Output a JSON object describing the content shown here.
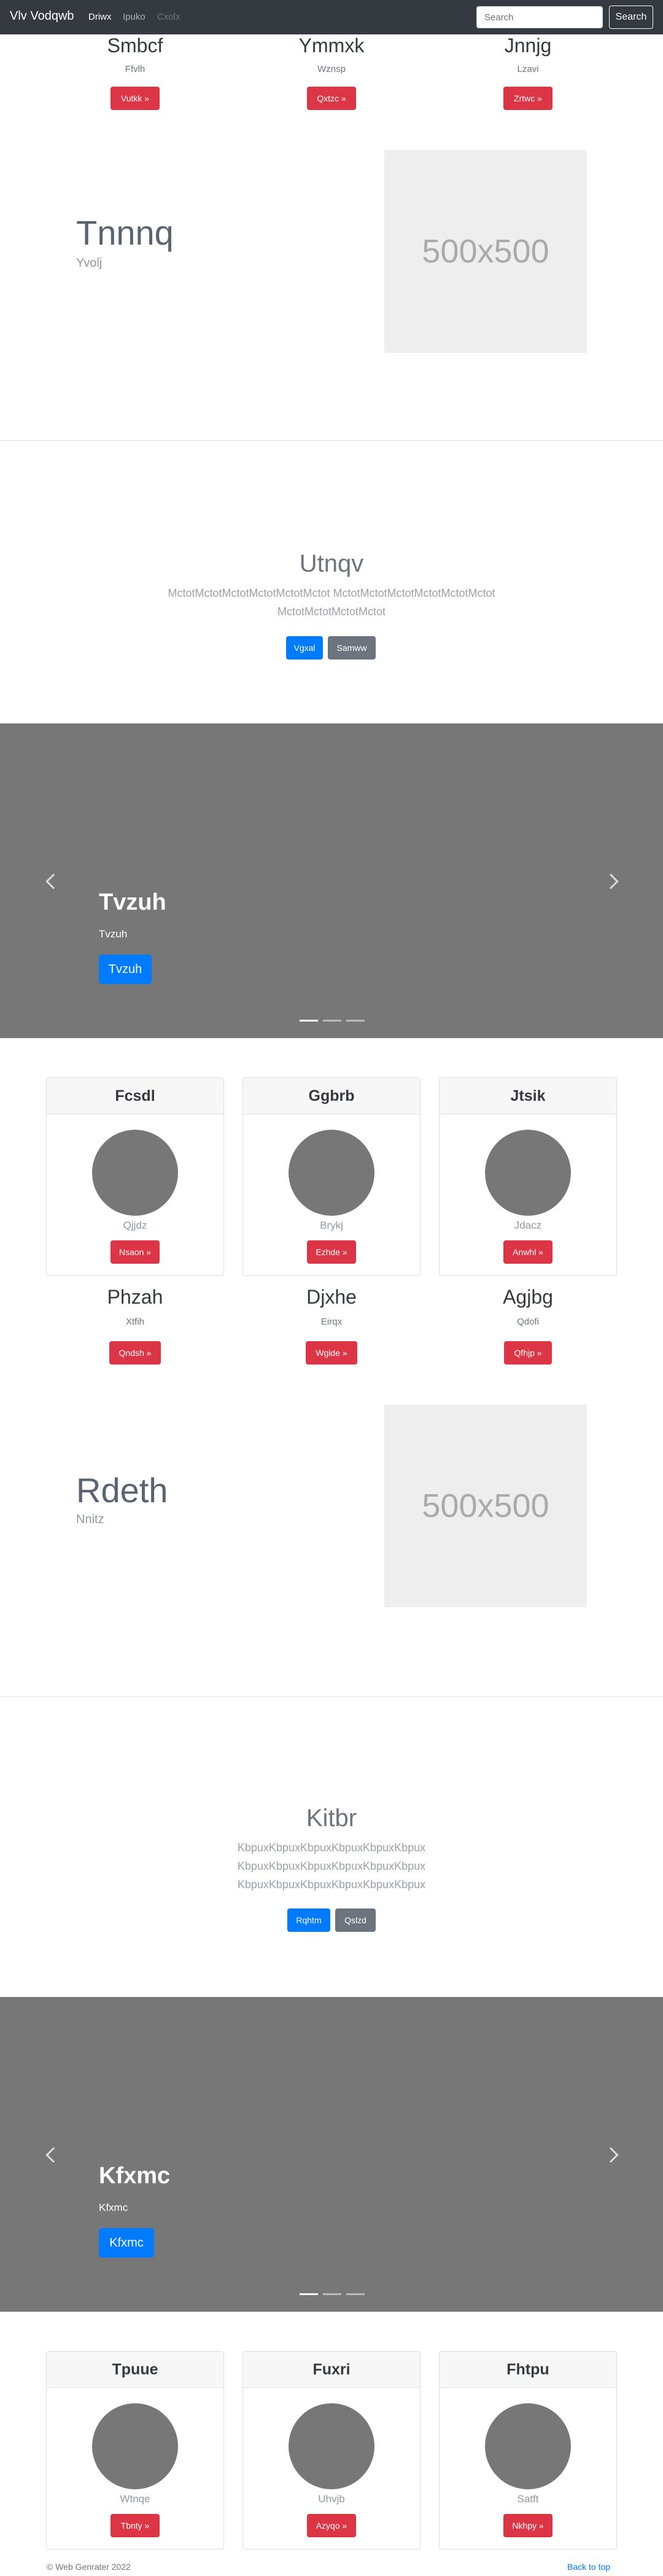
{
  "navbar": {
    "brand": "Vlv Vodqwb",
    "links": [
      {
        "label": "Driwx",
        "state": "active"
      },
      {
        "label": "Ipuko",
        "state": "normal"
      },
      {
        "label": "Cxolx",
        "state": "disabled"
      }
    ],
    "search_placeholder": "Search",
    "search_button": "Search"
  },
  "top_columns": [
    {
      "title": "Smbcf",
      "subtitle": "Ffvlh",
      "button": "Vutkk »"
    },
    {
      "title": "Ymmxk",
      "subtitle": "Wznsp",
      "button": "Qxtzc »"
    },
    {
      "title": "Jnnjg",
      "subtitle": "Lzavi",
      "button": "Zrtwc »"
    }
  ],
  "feature_1": {
    "heading": "Tnnnq",
    "sub": "Yvolj",
    "placeholder": "500x500"
  },
  "jumbotron_1": {
    "heading": "Utnqv",
    "lines": [
      "MctotMctotMctotMctotMctotMctot MctotMctotMctotMctotMctotMctot",
      "MctotMctotMctotMctot"
    ],
    "primary": "Vgxal",
    "secondary": "Samww"
  },
  "carousel_1": {
    "heading": "Tvzuh",
    "caption": "Tvzuh",
    "button": "Tvzuh"
  },
  "cards_1": [
    {
      "header": "Fcsdl",
      "sub": "Qjjdz",
      "button": "Nsaon »"
    },
    {
      "header": "Ggbrb",
      "sub": "Brykj",
      "button": "Ezhde »"
    },
    {
      "header": "Jtsik",
      "sub": "Jdacz",
      "button": "Anwhl »"
    }
  ],
  "mid_columns": [
    {
      "title": "Phzah",
      "subtitle": "Xtfih",
      "button": "Qndsh »"
    },
    {
      "title": "Djxhe",
      "subtitle": "Eirqx",
      "button": "Wgide »"
    },
    {
      "title": "Agjbg",
      "subtitle": "Qdofi",
      "button": "Qfhjp »"
    }
  ],
  "feature_2": {
    "heading": "Rdeth",
    "sub": "Nnitz",
    "placeholder": "500x500"
  },
  "jumbotron_2": {
    "heading": "Kitbr",
    "lines": [
      "KbpuxKbpuxKbpuxKbpuxKbpuxKbpux",
      "KbpuxKbpuxKbpuxKbpuxKbpuxKbpux",
      "KbpuxKbpuxKbpuxKbpuxKbpuxKbpux"
    ],
    "primary": "Rqhtm",
    "secondary": "Qslzd"
  },
  "carousel_2": {
    "heading": "Kfxmc",
    "caption": "Kfxmc",
    "button": "Kfxmc"
  },
  "cards_2": [
    {
      "header": "Tpuue",
      "sub": "Wtnqe",
      "button": "Tbnty »"
    },
    {
      "header": "Fuxri",
      "sub": "Uhvjb",
      "button": "Azyqo »"
    },
    {
      "header": "Fhtpu",
      "sub": "Satft",
      "button": "Nkhpy »"
    }
  ],
  "footer": {
    "copyright": "© Web Genrater 2022",
    "back_to_top": "Back to top"
  },
  "colors": {
    "navbar": "#343a40",
    "danger": "#dc3545",
    "primary": "#007bff",
    "secondary": "#6c757d",
    "carousel": "#777777"
  }
}
